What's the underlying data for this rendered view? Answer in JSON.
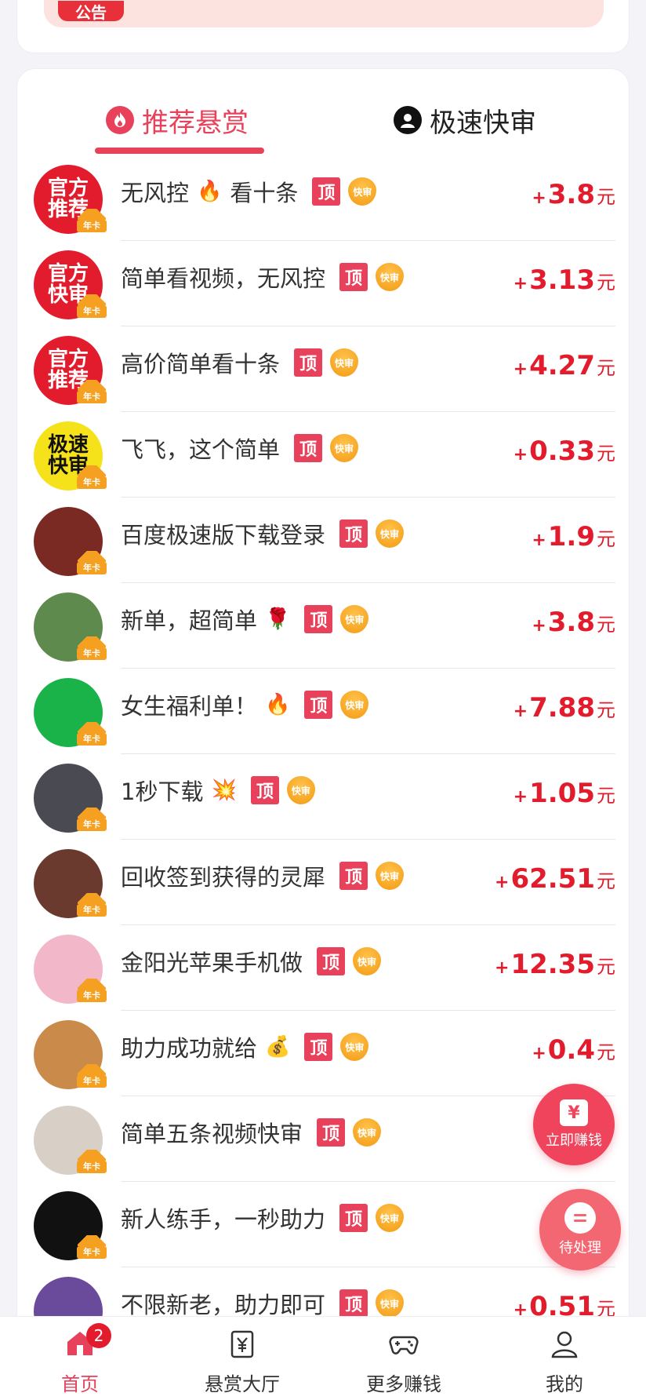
{
  "notice": {
    "badge": "公告"
  },
  "tabs": [
    {
      "label": "推荐悬赏",
      "active": true,
      "icon": "fire-icon"
    },
    {
      "label": "极速快审",
      "active": false,
      "icon": "user-circle-icon"
    }
  ],
  "badge_labels": {
    "top": "顶",
    "fast": "快审",
    "crown": "年卡",
    "currency": "元"
  },
  "tasks": [
    {
      "title": "无风控",
      "emoji": "🔥",
      "title_suffix": "看十条",
      "amount": "3.8",
      "avatar_text": "官方\n推荐",
      "avatar_bg": "#e21c2c",
      "avatar_fg": "#ffffff"
    },
    {
      "title": "简单看视频，无风控",
      "emoji": "",
      "title_suffix": "",
      "amount": "3.13",
      "avatar_text": "官方\n快审",
      "avatar_bg": "#e21c2c",
      "avatar_fg": "#ffffff"
    },
    {
      "title": "高价简单看十条",
      "emoji": "",
      "title_suffix": "",
      "amount": "4.27",
      "avatar_text": "官方\n推荐",
      "avatar_bg": "#e21c2c",
      "avatar_fg": "#ffffff"
    },
    {
      "title": "飞飞，这个简单",
      "emoji": "",
      "title_suffix": "",
      "amount": "0.33",
      "avatar_text": "极速\n快审",
      "avatar_bg": "#f6e21a",
      "avatar_fg": "#111111"
    },
    {
      "title": "百度极速版下载登录",
      "emoji": "",
      "title_suffix": "",
      "amount": "1.9",
      "avatar_text": "",
      "avatar_bg": "#7a2a22",
      "avatar_fg": "#ffffff"
    },
    {
      "title": "新单，超简单",
      "emoji": "🌹",
      "title_suffix": "",
      "amount": "3.8",
      "avatar_text": "",
      "avatar_bg": "#5e8a4e",
      "avatar_fg": "#ffffff"
    },
    {
      "title": "女生福利单！",
      "emoji": "🔥",
      "title_suffix": "",
      "amount": "7.88",
      "avatar_text": "",
      "avatar_bg": "#19b34a",
      "avatar_fg": "#ffffff"
    },
    {
      "title": "1秒下载",
      "emoji": "💥",
      "title_suffix": "",
      "amount": "1.05",
      "avatar_text": "",
      "avatar_bg": "#4a4a52",
      "avatar_fg": "#ffffff"
    },
    {
      "title": "回收签到获得的灵犀",
      "emoji": "",
      "title_suffix": "",
      "amount": "62.51",
      "avatar_text": "",
      "avatar_bg": "#6b3a2e",
      "avatar_fg": "#ffffff"
    },
    {
      "title": "金阳光苹果手机做",
      "emoji": "",
      "title_suffix": "",
      "amount": "12.35",
      "avatar_text": "",
      "avatar_bg": "#f2b7c8",
      "avatar_fg": "#ffffff"
    },
    {
      "title": "助力成功就给",
      "emoji": "💰",
      "title_suffix": "",
      "amount": "0.4",
      "avatar_text": "",
      "avatar_bg": "#c98a4a",
      "avatar_fg": "#ffffff"
    },
    {
      "title": "简单五条视频快审",
      "emoji": "",
      "title_suffix": "",
      "amount": "",
      "avatar_text": "",
      "avatar_bg": "#d8cfc6",
      "avatar_fg": "#ffffff"
    },
    {
      "title": "新人练手，一秒助力",
      "emoji": "",
      "title_suffix": "",
      "amount": "",
      "avatar_text": "",
      "avatar_bg": "#111111",
      "avatar_fg": "#ffffff"
    },
    {
      "title": "不限新老，助力即可",
      "emoji": "",
      "title_suffix": "",
      "amount": "0.51",
      "avatar_text": "",
      "avatar_bg": "#6a4a9a",
      "avatar_fg": "#ffffff"
    }
  ],
  "float_buttons": {
    "earn": {
      "label": "立即赚钱",
      "icon": "yen-icon"
    },
    "pending": {
      "label": "待处理",
      "icon": "chat-icon"
    }
  },
  "bottom_nav": {
    "items": [
      {
        "label": "首页",
        "icon": "home-icon",
        "active": true,
        "badge": "2"
      },
      {
        "label": "悬赏大厅",
        "icon": "yen-doc-icon",
        "active": false
      },
      {
        "label": "更多赚钱",
        "icon": "gamepad-icon",
        "active": false
      },
      {
        "label": "我的",
        "icon": "person-icon",
        "active": false
      }
    ]
  },
  "colors": {
    "accent": "#e8415b",
    "reward": "#e21c2c",
    "fast": "#f5a020"
  }
}
